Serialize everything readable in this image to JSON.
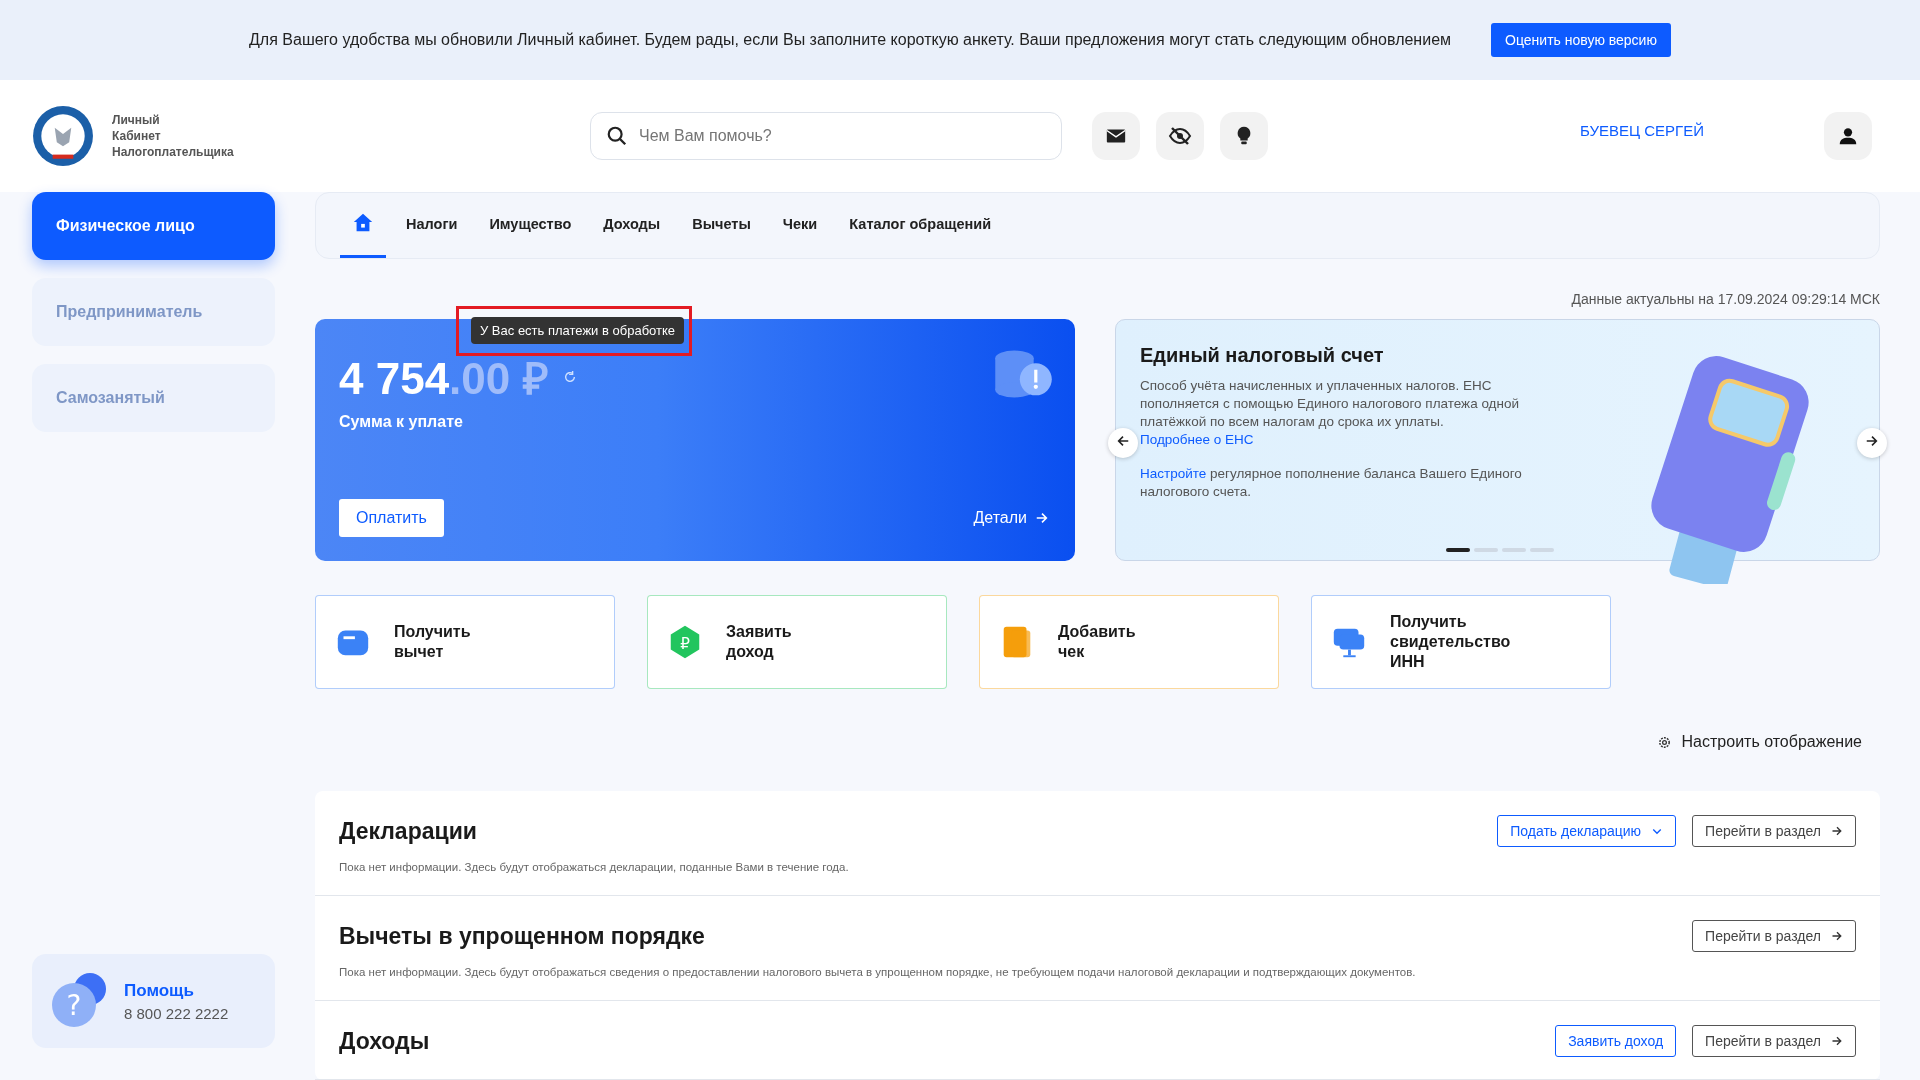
{
  "banner": {
    "text": "Для Вашего удобства мы обновили Личный кабинет. Будем рады, если Вы заполните короткую анкету. Ваши предложения могут стать следующим обновлением",
    "button": "Оценить новую версию"
  },
  "logo": {
    "lines": [
      "Личный",
      "Кабинет",
      "Налогоплательщика"
    ]
  },
  "search": {
    "placeholder": "Чем Вам помочь?"
  },
  "user": {
    "name": "БУЕВЕЦ СЕРГЕЙ"
  },
  "sidebar": {
    "items": [
      {
        "label": "Физическое лицо",
        "selected": true
      },
      {
        "label": "Предприниматель",
        "selected": false
      },
      {
        "label": "Самозанятый",
        "selected": false
      }
    ],
    "help": {
      "icon": "?",
      "title": "Помощь",
      "phone": "8 800 222 2222"
    }
  },
  "tabs": [
    {
      "kind": "home",
      "selected": true
    },
    {
      "label": "Налоги",
      "kind": "text",
      "selected": false
    },
    {
      "label": "Имущество",
      "kind": "text",
      "selected": false
    },
    {
      "label": "Доходы",
      "kind": "text",
      "selected": false
    },
    {
      "label": "Вычеты",
      "kind": "text",
      "selected": false
    },
    {
      "label": "Чеки",
      "kind": "text",
      "selected": false
    },
    {
      "label": "Каталог обращений",
      "kind": "text",
      "selected": false
    }
  ],
  "updated": "Данные актуальны на 17.09.2024 09:29:14 МСК",
  "balance": {
    "amount": "4 754",
    "fraction": ".00 ₽",
    "label": "Сумма к уплате",
    "pay_button": "Оплатить",
    "details": "Детали",
    "tooltip": "У Вас есть платежи в обработке"
  },
  "promo": {
    "title": "Единый налоговый счет",
    "text": "Способ учёта начисленных и уплаченных налогов. ЕНС пополняется с помощью Единого налогового платежа одной платёжкой по всем налогам до срока их уплаты.",
    "link": "Подробнее о ЕНС",
    "link2": "Настройте",
    "text2": "регулярное пополнение баланса Вашего Единого налогового счета.",
    "dots": [
      {
        "selected": true
      },
      {
        "selected": false
      },
      {
        "selected": false
      },
      {
        "selected": false
      }
    ]
  },
  "actions": [
    {
      "label": "Получить вычет",
      "kind": "wallet",
      "color": "#3b82f6"
    },
    {
      "label": "Заявить доход",
      "kind": "ruble",
      "glyph": "₽",
      "color": "#22c55e"
    },
    {
      "label": "Добавить чек",
      "kind": "receipt",
      "color": "#f59e0b"
    },
    {
      "label": "Получить свидетельство ИНН",
      "kind": "chat",
      "color": "#3b82f6"
    }
  ],
  "settings_link": "Настроить отображение",
  "sections": [
    {
      "title": "Декларации",
      "text": "Пока нет информации. Здесь будут отображаться декларации, поданные Вами в течение года.",
      "buttons": [
        {
          "label": "Подать декларацию",
          "kind": "dropdown"
        },
        {
          "label": "Перейти в раздел",
          "kind": "go"
        }
      ]
    },
    {
      "title": "Вычеты в упрощенном порядке",
      "text": "Пока нет информации. Здесь будут отображаться сведения о предоставлении налогового вычета в упрощенном порядке, не требующем подачи налоговой декларации и подтверждающих документов.",
      "buttons": [
        {
          "label": "Перейти в раздел",
          "kind": "go"
        }
      ]
    },
    {
      "title": "Доходы",
      "buttons": [
        {
          "label": "Заявить доход",
          "kind": "primary"
        },
        {
          "label": "Перейти в раздел",
          "kind": "go"
        }
      ]
    }
  ]
}
